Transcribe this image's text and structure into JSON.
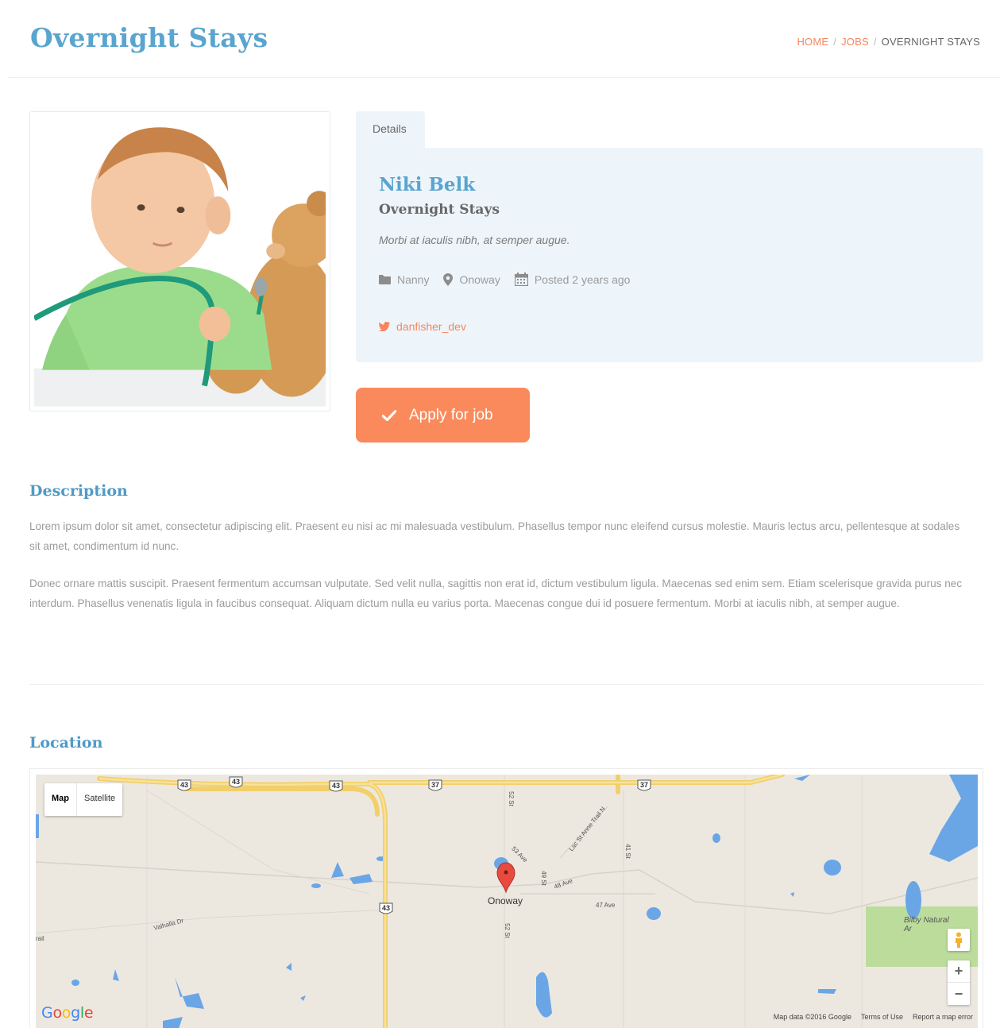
{
  "header": {
    "title": "Overnight Stays",
    "breadcrumb": {
      "home": "HOME",
      "sep": "/",
      "jobs": "JOBS",
      "current": "OVERNIGHT STAYS"
    }
  },
  "details": {
    "tab_label": "Details",
    "name": "Niki Belk",
    "job_title": "Overnight Stays",
    "tagline": "Morbi at iaculis nibh, at semper augue.",
    "category": "Nanny",
    "location": "Onoway",
    "posted": "Posted 2 years ago",
    "twitter_handle": "danfisher_dev"
  },
  "apply_button": {
    "label": "Apply for job"
  },
  "description": {
    "heading": "Description",
    "paragraphs": [
      "Lorem ipsum dolor sit amet, consectetur adipiscing elit. Praesent eu nisi ac mi malesuada vestibulum. Phasellus tempor nunc eleifend cursus molestie. Mauris lectus arcu, pellentesque at sodales sit amet, condimentum id nunc.",
      "Donec ornare mattis suscipit. Praesent fermentum accumsan vulputate. Sed velit nulla, sagittis non erat id, dictum vestibulum ligula. Maecenas sed enim sem. Etiam scelerisque gravida purus nec interdum. Phasellus venenatis ligula in faucibus consequat. Aliquam dictum nulla eu varius porta. Maecenas congue dui id posuere fermentum. Morbi at iaculis nibh, at semper augue."
    ]
  },
  "location": {
    "heading": "Location",
    "map": {
      "type_map": "Map",
      "type_satellite": "Satellite",
      "town": "Onoway",
      "highway_shields": [
        "43",
        "43",
        "43",
        "37",
        "37",
        "43"
      ],
      "streets": [
        "52 St",
        "53 Ave",
        "Lac St Anne Trail N",
        "41 St",
        "49 St",
        "48 Ave",
        "47 Ave",
        "Valhalla Dr",
        "52 St",
        "rail"
      ],
      "park": "Bilby Natural Ar",
      "zoom_in": "+",
      "zoom_out": "−",
      "attribution": "Map data ©2016 Google",
      "terms": "Terms of Use",
      "report": "Report a map error"
    }
  },
  "colors": {
    "accent_blue": "#59a5cf",
    "accent_orange": "#fa8a5b",
    "panel_bg": "#eef5fa",
    "map_bg": "#ece8e0",
    "highway": "#f5d56c",
    "water": "#6aa6e6",
    "park": "#bcdc9c"
  },
  "icons": {
    "category": "folder-icon",
    "location": "map-marker-icon",
    "posted": "calendar-icon",
    "twitter": "twitter-icon",
    "apply": "check-icon"
  }
}
